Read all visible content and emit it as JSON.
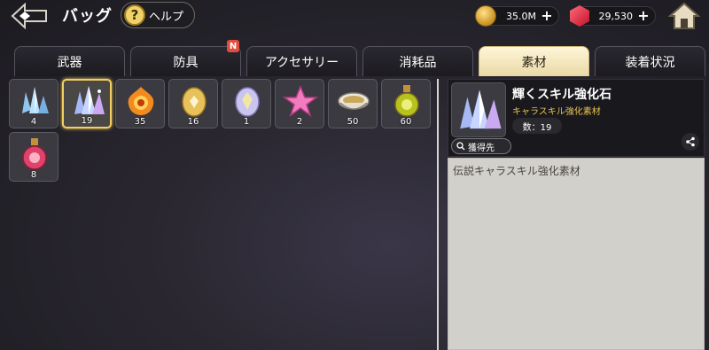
{
  "header": {
    "title": "バッグ",
    "help_label": "ヘルプ",
    "gold": "35.0M",
    "gems": "29,530"
  },
  "tabs": [
    {
      "label": "武器"
    },
    {
      "label": "防具",
      "badge": "N"
    },
    {
      "label": "アクセサリー"
    },
    {
      "label": "消耗品"
    },
    {
      "label": "素材"
    },
    {
      "label": "装着状況"
    }
  ],
  "active_tab": "素材",
  "items": [
    {
      "icon": "blue-crystal-icon",
      "count": "4"
    },
    {
      "icon": "shining-crystal-icon",
      "count": "19"
    },
    {
      "icon": "fire-emblem-icon",
      "count": "35"
    },
    {
      "icon": "golden-egg-icon",
      "count": "16"
    },
    {
      "icon": "pearl-egg-icon",
      "count": "1"
    },
    {
      "icon": "pink-star-icon",
      "count": "2"
    },
    {
      "icon": "soup-bowl-icon",
      "count": "50"
    },
    {
      "icon": "green-potion-icon",
      "count": "60"
    },
    {
      "icon": "red-potion-icon",
      "count": "8"
    }
  ],
  "detail": {
    "name": "輝くスキル強化石",
    "subtitle": "キャラスキル強化素材",
    "count": "数：19",
    "obtain_label": "獲得先",
    "description": "伝説キャラスキル強化素材"
  },
  "colors": {
    "accent_gold": "#e7c354",
    "active_tab": "#fff6d8",
    "badge_red": "#e34d3f"
  }
}
